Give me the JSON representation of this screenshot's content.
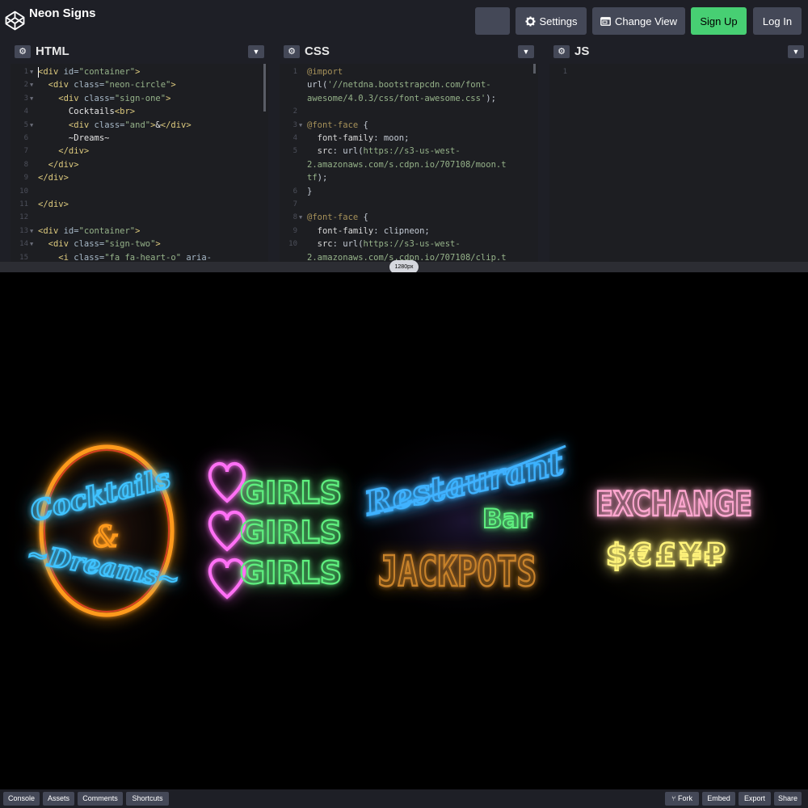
{
  "app": {
    "title": "Neon Signs"
  },
  "header_buttons": {
    "settings": "Settings",
    "change_view": "Change View",
    "sign_up": "Sign Up",
    "log_in": "Log In"
  },
  "editors": {
    "html": {
      "title": "HTML",
      "lines": [
        {
          "n": "1",
          "fold": true,
          "segs": [
            {
              "t": "<div ",
              "c": "c-tag"
            },
            {
              "t": "id=",
              "c": "c-attr"
            },
            {
              "t": "\"container\"",
              "c": "c-str"
            },
            {
              "t": ">",
              "c": "c-tag"
            }
          ]
        },
        {
          "n": "2",
          "fold": true,
          "segs": [
            {
              "t": "  <div ",
              "c": "c-tag"
            },
            {
              "t": "class=",
              "c": "c-attr"
            },
            {
              "t": "\"neon-circle\"",
              "c": "c-str"
            },
            {
              "t": ">",
              "c": "c-tag"
            }
          ]
        },
        {
          "n": "3",
          "fold": true,
          "segs": [
            {
              "t": "    <div ",
              "c": "c-tag"
            },
            {
              "t": "class=",
              "c": "c-attr"
            },
            {
              "t": "\"sign-one\"",
              "c": "c-str"
            },
            {
              "t": ">",
              "c": "c-tag"
            }
          ]
        },
        {
          "n": "4",
          "fold": false,
          "segs": [
            {
              "t": "      Cocktails",
              "c": "c-txt"
            },
            {
              "t": "<br>",
              "c": "c-tag"
            }
          ]
        },
        {
          "n": "5",
          "fold": true,
          "segs": [
            {
              "t": "      <div ",
              "c": "c-tag"
            },
            {
              "t": "class=",
              "c": "c-attr"
            },
            {
              "t": "\"and\"",
              "c": "c-str"
            },
            {
              "t": ">",
              "c": "c-tag"
            },
            {
              "t": "&",
              "c": "c-txt"
            },
            {
              "t": "</div>",
              "c": "c-tag"
            }
          ]
        },
        {
          "n": "6",
          "fold": false,
          "segs": [
            {
              "t": "      ~Dreams~",
              "c": "c-txt"
            }
          ]
        },
        {
          "n": "7",
          "fold": false,
          "segs": [
            {
              "t": "    </div>",
              "c": "c-tag"
            }
          ]
        },
        {
          "n": "8",
          "fold": false,
          "segs": [
            {
              "t": "  </div>",
              "c": "c-tag"
            }
          ]
        },
        {
          "n": "9",
          "fold": false,
          "segs": [
            {
              "t": "</div>",
              "c": "c-tag"
            }
          ]
        },
        {
          "n": "10",
          "fold": false,
          "segs": []
        },
        {
          "n": "11",
          "fold": false,
          "segs": [
            {
              "t": "</div>",
              "c": "c-tag"
            }
          ]
        },
        {
          "n": "12",
          "fold": false,
          "segs": []
        },
        {
          "n": "13",
          "fold": true,
          "segs": [
            {
              "t": "<div ",
              "c": "c-tag"
            },
            {
              "t": "id=",
              "c": "c-attr"
            },
            {
              "t": "\"container\"",
              "c": "c-str"
            },
            {
              "t": ">",
              "c": "c-tag"
            }
          ]
        },
        {
          "n": "14",
          "fold": true,
          "segs": [
            {
              "t": "  <div ",
              "c": "c-tag"
            },
            {
              "t": "class=",
              "c": "c-attr"
            },
            {
              "t": "\"sign-two\"",
              "c": "c-str"
            },
            {
              "t": ">",
              "c": "c-tag"
            }
          ]
        },
        {
          "n": "15",
          "fold": false,
          "segs": [
            {
              "t": "    <i ",
              "c": "c-tag"
            },
            {
              "t": "class=",
              "c": "c-attr"
            },
            {
              "t": "\"fa fa-heart-o\"",
              "c": "c-str"
            },
            {
              "t": " aria-",
              "c": "c-attr"
            }
          ]
        }
      ]
    },
    "css": {
      "title": "CSS",
      "lines": [
        {
          "n": "1",
          "fold": false,
          "segs": [
            {
              "t": "@import",
              "c": "c-kw"
            }
          ]
        },
        {
          "n": "",
          "fold": false,
          "segs": [
            {
              "t": "url(",
              "c": "c-val"
            },
            {
              "t": "'//netdna.bootstrapcdn.com/font-",
              "c": "c-str"
            }
          ]
        },
        {
          "n": "",
          "fold": false,
          "segs": [
            {
              "t": "awesome/4.0.3/css/font-awesome.css'",
              "c": "c-str"
            },
            {
              "t": ");",
              "c": "c-val"
            }
          ]
        },
        {
          "n": "2",
          "fold": false,
          "segs": []
        },
        {
          "n": "3",
          "fold": true,
          "segs": [
            {
              "t": "@font-face",
              "c": "c-kw"
            },
            {
              "t": " {",
              "c": "c-val"
            }
          ]
        },
        {
          "n": "4",
          "fold": false,
          "segs": [
            {
              "t": "  font-family",
              "c": "c-prop"
            },
            {
              "t": ": moon;",
              "c": "c-val"
            }
          ]
        },
        {
          "n": "5",
          "fold": false,
          "segs": [
            {
              "t": "  src",
              "c": "c-prop"
            },
            {
              "t": ": url(",
              "c": "c-val"
            },
            {
              "t": "https://s3-us-west-",
              "c": "c-str"
            }
          ]
        },
        {
          "n": "",
          "fold": false,
          "segs": [
            {
              "t": "2.amazonaws.com/s.cdpn.io/707108/moon.t",
              "c": "c-str"
            }
          ]
        },
        {
          "n": "",
          "fold": false,
          "segs": [
            {
              "t": "tf",
              "c": "c-str"
            },
            {
              "t": ");",
              "c": "c-val"
            }
          ]
        },
        {
          "n": "6",
          "fold": false,
          "segs": [
            {
              "t": "}",
              "c": "c-val"
            }
          ]
        },
        {
          "n": "7",
          "fold": false,
          "segs": []
        },
        {
          "n": "8",
          "fold": true,
          "segs": [
            {
              "t": "@font-face",
              "c": "c-kw"
            },
            {
              "t": " {",
              "c": "c-val"
            }
          ]
        },
        {
          "n": "9",
          "fold": false,
          "segs": [
            {
              "t": "  font-family",
              "c": "c-prop"
            },
            {
              "t": ": clipneon;",
              "c": "c-val"
            }
          ]
        },
        {
          "n": "10",
          "fold": false,
          "segs": [
            {
              "t": "  src",
              "c": "c-prop"
            },
            {
              "t": ": url(",
              "c": "c-val"
            },
            {
              "t": "https://s3-us-west-",
              "c": "c-str"
            }
          ]
        },
        {
          "n": "",
          "fold": false,
          "segs": [
            {
              "t": "2.amazonaws.com/s.cdpn.io/707108/clip.t",
              "c": "c-str"
            }
          ]
        }
      ]
    },
    "js": {
      "title": "JS",
      "lines": [
        {
          "n": "1",
          "fold": false,
          "segs": []
        }
      ]
    }
  },
  "width_indicator": "1280px",
  "preview": {
    "sign_cocktails": {
      "line1": "Cocktails",
      "amp": "&",
      "line2": "~Dreams~",
      "ring_color": "#ff9a1f",
      "text_color": "#2bb5ff"
    },
    "sign_girls": {
      "word": "GIRLS",
      "rows": 3,
      "heart_color": "#ff5cf4",
      "text_color": "#59f07a"
    },
    "sign_restaurant": {
      "line1": "Restaurant",
      "line2": "Bar",
      "line3": "JACKPOTS",
      "color1": "#2aa6ff",
      "color2": "#53f07a",
      "color3": "#c8822a"
    },
    "sign_exchange": {
      "word": "EXCHANGE",
      "symbols": "$€£¥₽",
      "color1": "#ff9ecb",
      "color2": "#fff37a"
    }
  },
  "footer": {
    "left": [
      "Console",
      "Assets",
      "Comments",
      "Shortcuts"
    ],
    "right": [
      "Fork",
      "Embed",
      "Export",
      "Share"
    ]
  }
}
